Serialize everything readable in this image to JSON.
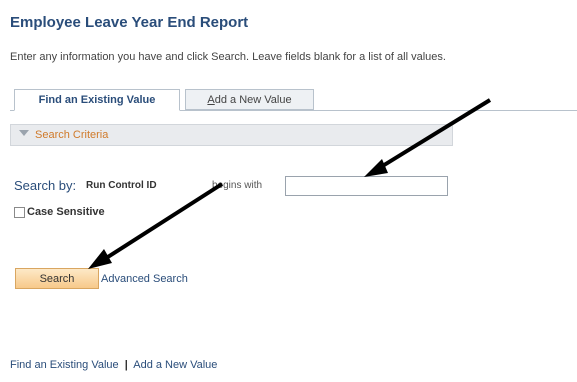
{
  "page": {
    "title": "Employee Leave Year End Report",
    "instructions": "Enter any information you have and click Search. Leave fields blank for a list of all values."
  },
  "tabs": [
    {
      "label": "Find an Existing Value",
      "active": true
    },
    {
      "label_underlined": "A",
      "label_rest": "dd a New Value",
      "active": false
    }
  ],
  "criteria": {
    "label": "Search Criteria"
  },
  "search": {
    "search_by_label": "Search by:",
    "field_label": "Run Control ID",
    "operator": "begins with",
    "field_value": "",
    "case_sensitive_label": "Case Sensitive",
    "case_sensitive_checked": false,
    "search_button": "Search",
    "advanced_link": "Advanced Search"
  },
  "footer_links": {
    "find": "Find an Existing Value",
    "separator": "|",
    "add": "Add a New Value"
  },
  "colors": {
    "title": "#2a4d7a",
    "criteria_label": "#d07a2a",
    "search_button": "#f7c98a",
    "annotation_arrows": "#000000"
  }
}
